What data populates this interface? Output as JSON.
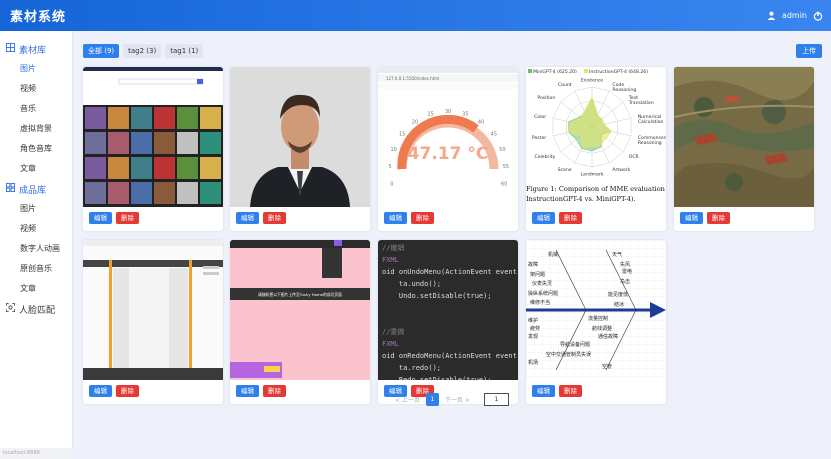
{
  "app": {
    "title": "素材系统",
    "user": "admin"
  },
  "sidebar": {
    "group1": {
      "label": "素材库",
      "items": [
        "图片",
        "视频",
        "音乐",
        "虚拟背景",
        "角色音库",
        "文章"
      ]
    },
    "group2": {
      "label": "成品库",
      "items": [
        "图片",
        "视频",
        "数字人动画",
        "原创音乐",
        "文章"
      ]
    },
    "group3": {
      "label": "人脸匹配"
    },
    "active_item": "图片",
    "footer": "localhost:8888"
  },
  "filters": {
    "tags": [
      "全部 (9)",
      "tag2 (3)",
      "tag1 (1)"
    ],
    "active": 0
  },
  "upload_label": "上传",
  "card_buttons": {
    "edit": "编辑",
    "delete": "删除"
  },
  "cards": [
    {
      "kind": "screenshot-grid"
    },
    {
      "kind": "portrait"
    },
    {
      "kind": "gauge",
      "gauge_value": "47.17 °C",
      "browser_url": "127.0.0.1:5500/index.html",
      "ticks": [
        "0",
        "5",
        "10",
        "15",
        "20",
        "25",
        "30",
        "35",
        "40",
        "45",
        "50",
        "55",
        "60"
      ]
    },
    {
      "kind": "radar",
      "legend": [
        "MiniGPT-4 (625.20)",
        "InstructionGPT-4 (648.26)"
      ],
      "axes": [
        "Existence",
        "Code Reasoning",
        "Text Translation",
        "Numerical Calculation",
        "Commonsense Reasoning",
        "OCR",
        "Artwork",
        "Landmark",
        "Scene",
        "Celebrity",
        "Poster",
        "Color",
        "Position",
        "Count"
      ],
      "caption_line1": "Figure 1: Comparison of MME evaluation",
      "caption_line2": "InstructionGPT-4 vs. MiniGPT-4)."
    },
    {
      "kind": "painting"
    },
    {
      "kind": "webpage"
    },
    {
      "kind": "pink-page",
      "banner": "请随机把以下图片上传至Tushy Home的成功页面"
    },
    {
      "kind": "code",
      "lines": [
        "//撤销",
        "FXML",
        "oid onUndoMenu(ActionEvent event) {",
        "    ta.undo();",
        "    Undo.setDisable(true);",
        "",
        "",
        "//重做",
        "FXML",
        "oid onRedoMenu(ActionEvent event) {",
        "    ta.redo();",
        "    Redo.setDisable(true);"
      ]
    },
    {
      "kind": "fishbone",
      "labels_top": [
        "机械",
        "天气",
        "故障",
        "失风",
        "架问题",
        "雷电",
        "仪表失灵",
        "鸟击",
        "操纵系统问题",
        "能见度低",
        "维修不当",
        "结冰"
      ],
      "labels_bottom": [
        "维护",
        "流量控制",
        "疲劳",
        "航线调整",
        "发现",
        "通信故障",
        "导航设备问题",
        "空中交通管制员失误",
        "机场",
        "空管"
      ]
    }
  ],
  "pagination": {
    "prev": "< 上一页",
    "current": "1",
    "next": "下一页 >",
    "jump": "1"
  }
}
